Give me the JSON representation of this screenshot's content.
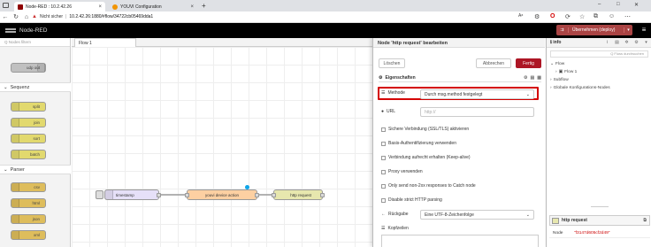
{
  "browser": {
    "tabs": [
      {
        "title": "Node-RED : 10.2.42.26",
        "active": true
      },
      {
        "title": "YOUVI Configuration",
        "active": false
      }
    ],
    "new_tab": "+",
    "security_warning": "Nicht sicher",
    "url": "10.2.42.26:1880/#flow/34722cb05469dda1",
    "window_controls": [
      "–",
      "□",
      "✕"
    ]
  },
  "app": {
    "title": "Node-RED",
    "deploy_label": "Übernehmen (deploy)",
    "menu_icon": "hamburger-icon"
  },
  "palette": {
    "filter_placeholder": "Q Nodes filtern",
    "top_node": "udp out",
    "categories": [
      {
        "label": "Sequenz",
        "nodes": [
          "split",
          "join",
          "sort",
          "batch"
        ]
      },
      {
        "label": "Parser",
        "nodes": [
          "csv",
          "html",
          "json",
          "xml"
        ]
      }
    ]
  },
  "workspace": {
    "tab": "Flow 1",
    "nodes": [
      "timestamp",
      "youvi device action",
      "http request"
    ]
  },
  "tray": {
    "title": "Node 'http request' bearbeiten",
    "delete_label": "Löschen",
    "cancel_label": "Abbrechen",
    "done_label": "Fertig",
    "properties_tab": "Eigenschaften",
    "method_label": "Methode",
    "method_value": "Durch msg.method festgelegt",
    "url_label": "URL",
    "url_placeholder": "http://",
    "checkboxes": [
      "Sichere Verbindung (SSL/TLS) aktivieren",
      "Basis-Authentifizierung verwenden",
      "Verbindung aufrecht erhalten (Keep-alive)",
      "Proxy verwenden",
      "Only send non-2xx responses to Catch node",
      "Disable strict HTTP parsing"
    ],
    "return_label": "Rückgabe",
    "return_value": "Eine UTF-8-Zeichenfolge",
    "headers_label": "Kopfzeilen"
  },
  "sidebar": {
    "tab_label": "info",
    "filter_placeholder": "Q Fluss durchsuchen",
    "tree": [
      "Flow",
      "Flow 1",
      "Subflow",
      "Globale Konfigurations-Nodes"
    ],
    "info_node_title": "http request",
    "info_rows": [
      {
        "key": "Node",
        "value": "\"f3147d605cf2d49\""
      }
    ]
  },
  "colors": {
    "deploy_bg": "#aa4444",
    "done_bg": "#ad1625",
    "highlight": "#d40000",
    "sequence_node": "#e2d96e",
    "parser_node": "#debd5c",
    "youvi_node": "#fdd0a2"
  }
}
